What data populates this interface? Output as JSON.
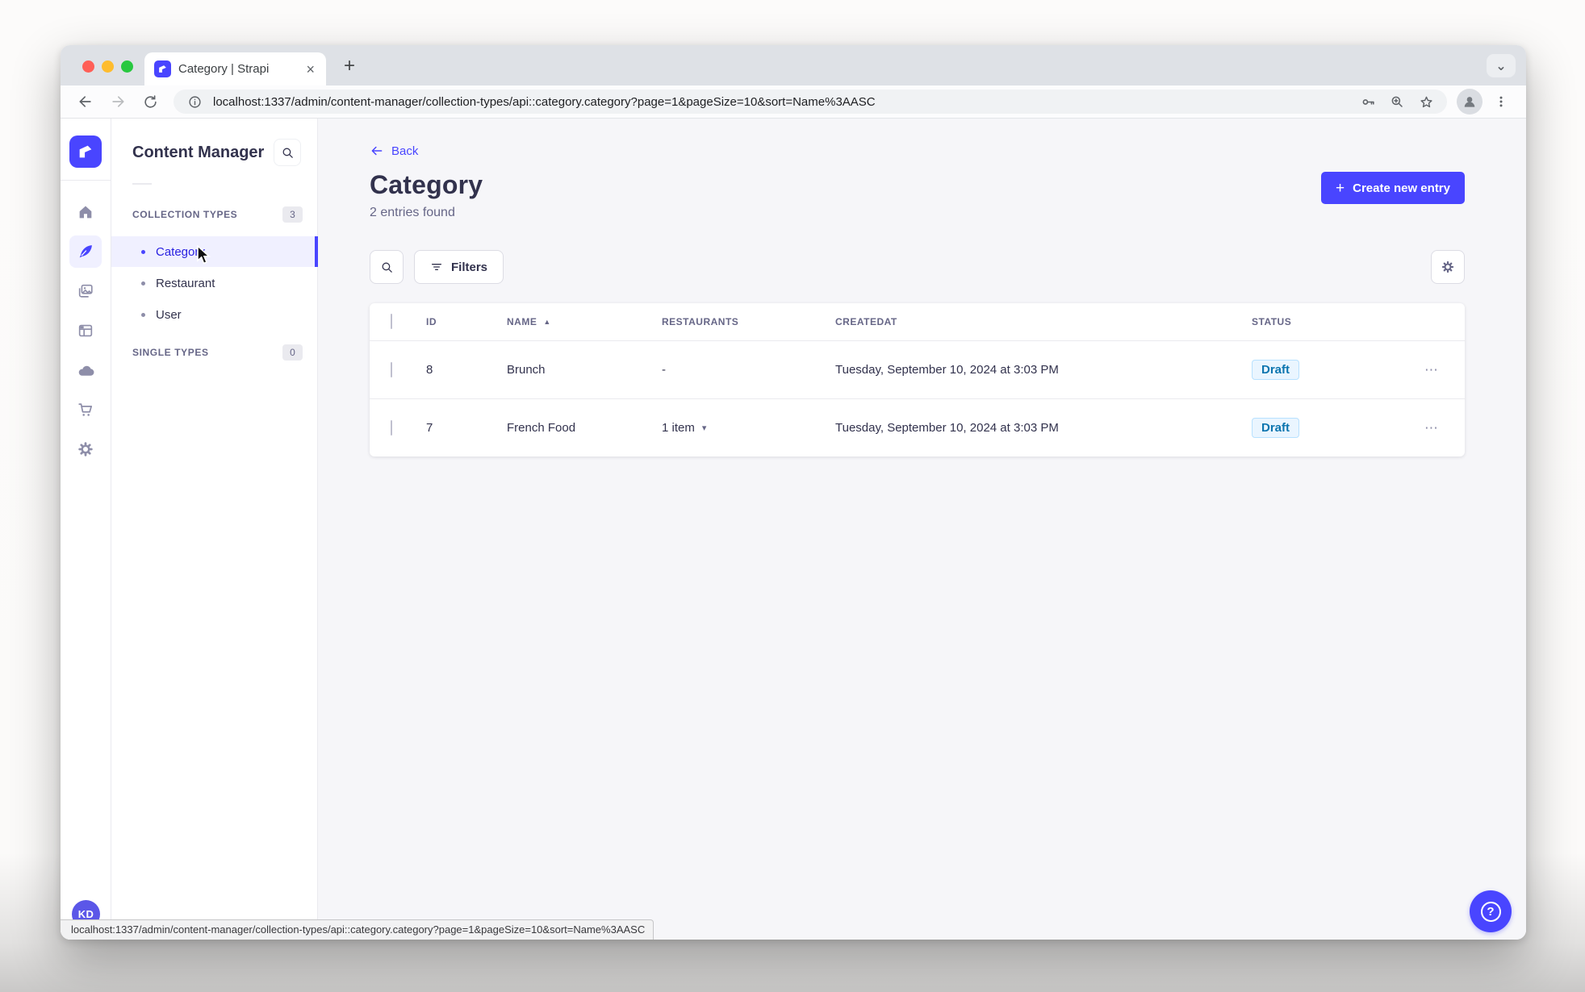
{
  "browser": {
    "tab": {
      "title": "Category | Strapi"
    },
    "url": "localhost:1337/admin/content-manager/collection-types/api::category.category?page=1&pageSize=10&sort=Name%3AASC",
    "status_url": "localhost:1337/admin/content-manager/collection-types/api::category.category?page=1&pageSize=10&sort=Name%3AASC"
  },
  "icons": {
    "close_tab": "×",
    "new_tab": "+",
    "chevron_down": "⌄",
    "plus": "+",
    "sort_ascending": "▲",
    "caret_down": "▾",
    "row_actions": "⋯",
    "help": "?"
  },
  "sidebar": {
    "user_initials": "KD",
    "items": [
      {
        "name": "home"
      },
      {
        "name": "content-manager",
        "active": true
      },
      {
        "name": "media-library"
      },
      {
        "name": "content-type-builder"
      },
      {
        "name": "cloud"
      },
      {
        "name": "marketplace"
      },
      {
        "name": "settings"
      }
    ]
  },
  "subnav": {
    "title": "Content Manager",
    "sections": [
      {
        "label": "COLLECTION TYPES",
        "count": "3",
        "items": [
          {
            "label": "Category",
            "active": true
          },
          {
            "label": "Restaurant",
            "active": false
          },
          {
            "label": "User",
            "active": false
          }
        ]
      },
      {
        "label": "SINGLE TYPES",
        "count": "0",
        "items": []
      }
    ]
  },
  "main": {
    "back_label": "Back",
    "title": "Category",
    "subtitle": "2 entries found",
    "create_button_label": "Create new entry",
    "filters_button_label": "Filters",
    "table": {
      "columns": [
        "ID",
        "NAME",
        "RESTAURANTS",
        "CREATEDAT",
        "STATUS"
      ],
      "sorted_by": "NAME ascending",
      "rows": [
        {
          "id": "8",
          "name": "Brunch",
          "restaurants": "-",
          "created_at": "Tuesday, September 10, 2024 at 3:03 PM",
          "status": "Draft"
        },
        {
          "id": "7",
          "name": "French Food",
          "restaurants": "1 item",
          "created_at": "Tuesday, September 10, 2024 at 3:03 PM",
          "status": "Draft"
        }
      ]
    }
  },
  "colors": {
    "primary": "#4945ff",
    "active_item_bg": "#f0f0ff",
    "active_item_text": "#271fe0",
    "draft_bg": "#eaf5ff",
    "draft_border": "#b8e1ff",
    "draft_text": "#0c75af",
    "traffic_red": "#ff5f57",
    "traffic_yellow": "#febc2e",
    "traffic_green": "#28c840"
  }
}
